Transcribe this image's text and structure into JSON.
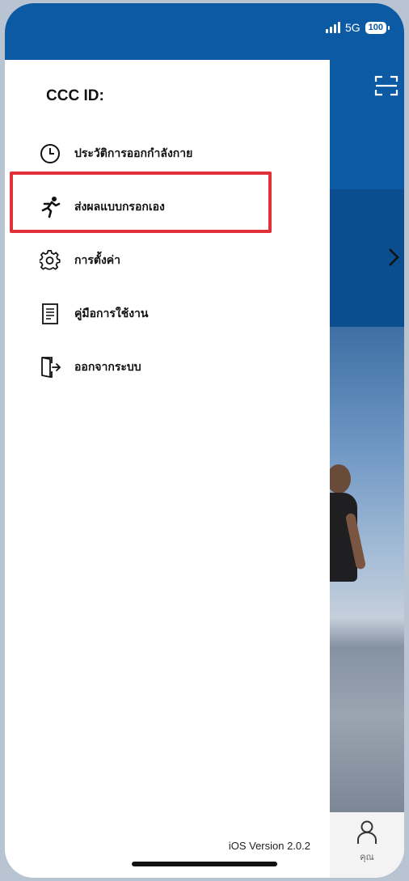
{
  "status_bar": {
    "network": "5G",
    "battery": "100"
  },
  "drawer": {
    "title": "CCC ID:",
    "menu_items": [
      {
        "label": "ประวัติการออกกำลังกาย",
        "icon": "clock-icon"
      },
      {
        "label": "ส่งผลแบบกรอกเอง",
        "icon": "running-person-icon"
      },
      {
        "label": "การตั้งค่า",
        "icon": "gear-icon"
      },
      {
        "label": "คู่มือการใช้งาน",
        "icon": "document-icon"
      },
      {
        "label": "ออกจากระบบ",
        "icon": "logout-door-icon"
      }
    ],
    "version": "iOS Version 2.0.2"
  },
  "background_app": {
    "bottom_nav_label": "คุณ"
  },
  "colors": {
    "brand_blue": "#0c5aa3",
    "highlight_red": "#e0303a"
  }
}
